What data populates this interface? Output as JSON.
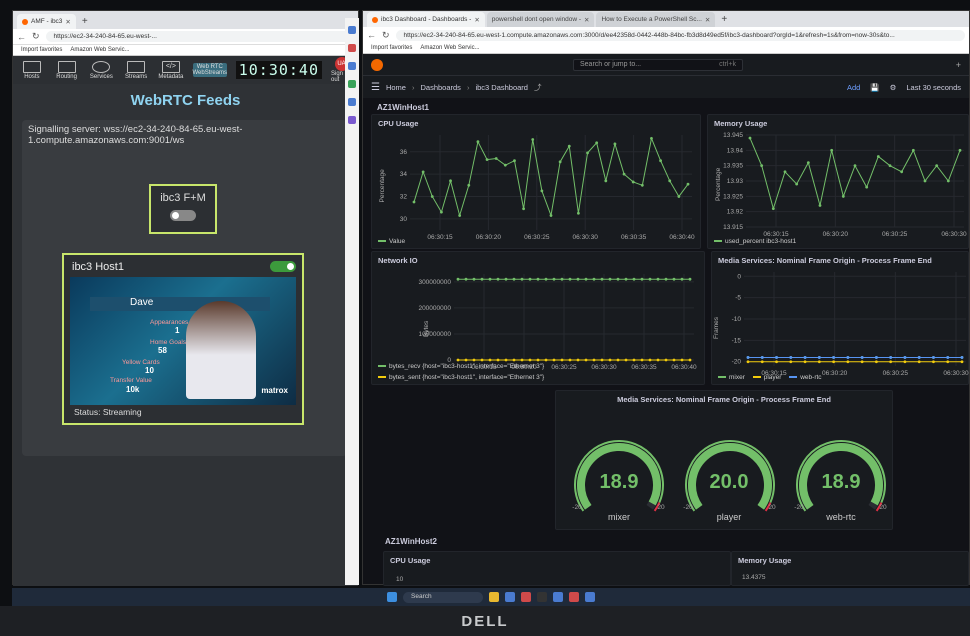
{
  "left_window": {
    "tabs": [
      {
        "label": "AMF - ibc3"
      }
    ],
    "url": "https://ec2-34-240-84-65.eu-west-...",
    "favorites": [
      "Import favorites",
      "Amazon Web Servic..."
    ],
    "nav": [
      {
        "label": "Hosts",
        "icon": "hosts-icon"
      },
      {
        "label": "Routing",
        "icon": "routing-icon"
      },
      {
        "label": "Services",
        "icon": "services-icon"
      },
      {
        "label": "Streams",
        "icon": "streams-icon"
      },
      {
        "label": "Metadata",
        "icon": "metadata-icon"
      },
      {
        "label": "WebStreams",
        "icon": "web-rtc-icon",
        "sub": "Web RTC",
        "active": true
      }
    ],
    "clock": "10:30:40",
    "avatar": "UA",
    "signout": "Sign out",
    "page_title": "WebRTC Feeds",
    "signalling": "Signalling server: wss://ec2-34-240-84-65.eu-west-1.compute.amazonaws.com:9001/ws",
    "fm_label": "ibc3 F+M",
    "host_title": "ibc3 Host1",
    "status": "Status: Streaming",
    "video": {
      "name": "Dave",
      "stats": [
        {
          "label": "Appearances",
          "value": "1"
        },
        {
          "label": "Home Goals",
          "value": "58"
        },
        {
          "label": "Yellow Cards",
          "value": "10"
        },
        {
          "label": "Transfer Value",
          "value": "10k"
        }
      ],
      "brand": "matrox"
    }
  },
  "right_window": {
    "tabs": [
      {
        "label": "ibc3 Dashboard - Dashboards -"
      },
      {
        "label": "powershell dont open window -"
      },
      {
        "label": "How to Execute a PowerShell Sc..."
      }
    ],
    "url": "https://ec2-34-240-84-65.eu-west-1.compute.amazonaws.com:3000/d/ee42358d-0442-448b-84bc-fb3d8d49ed5f/ibc3-dashboard?orgId=1&refresh=1s&from=now-30s&to...",
    "favorites": [
      "Import favorites",
      "Amazon Web Servic..."
    ],
    "search_placeholder": "Search or jump to...",
    "search_shortcut": "ctrl+k",
    "breadcrumb": [
      "Home",
      "Dashboards",
      "ibc3 Dashboard"
    ],
    "add_label": "Add",
    "time_range": "Last 30 seconds",
    "row1": "AZ1WinHost1",
    "row2": "AZ1WinHost2",
    "panels": {
      "cpu": {
        "title": "CPU Usage",
        "ylabel": "Percentage",
        "legend": "Value",
        "yticks": [
          "36",
          "34",
          "32",
          "30"
        ],
        "xticks": [
          "06:30:15",
          "06:30:20",
          "06:30:25",
          "06:30:30",
          "06:30:35",
          "06:30:40"
        ]
      },
      "mem": {
        "title": "Memory Usage",
        "ylabel": "Percentage",
        "legend": "used_percent ibc3-host1",
        "yticks": [
          "13.945",
          "13.94",
          "13.935",
          "13.93",
          "13.925",
          "13.92",
          "13.915"
        ],
        "xticks": [
          "06:30:15",
          "06:30:20",
          "06:30:25",
          "06:30:30"
        ]
      },
      "net": {
        "title": "Network IO",
        "ylabel": "Bytes",
        "yticks": [
          "300000000",
          "200000000",
          "100000000",
          "0"
        ],
        "xticks": [
          "06:30:15",
          "06:30:20",
          "06:30:25",
          "06:30:30",
          "06:30:35",
          "06:30:40"
        ],
        "legend": [
          "bytes_recv {host=\"ibc3-host1\", interface=\"Ethernet 3\"}",
          "bytes_sent {host=\"ibc3-host1\", interface=\"Ethernet 3\"}"
        ]
      },
      "frames": {
        "title": "Media Services: Nominal Frame Origin - Process Frame End",
        "ylabel": "Frames",
        "yticks": [
          "0",
          "-5",
          "-10",
          "-15",
          "-20"
        ],
        "xticks": [
          "06:30:15",
          "06:30:20",
          "06:30:25",
          "06:30:30"
        ],
        "legend": [
          "mixer",
          "player",
          "web-rtc"
        ]
      },
      "gauges": {
        "title": "Media Services: Nominal Frame Origin - Process Frame End",
        "items": [
          {
            "label": "mixer",
            "value": "18.9"
          },
          {
            "label": "player",
            "value": "20.0"
          },
          {
            "label": "web-rtc",
            "value": "18.9"
          }
        ],
        "min": "-20",
        "max": "20"
      },
      "cpu2": {
        "title": "CPU Usage",
        "ytick": "10"
      },
      "mem2": {
        "title": "Memory Usage",
        "value": "13.4375"
      }
    }
  },
  "taskbar": {
    "search": "Search"
  },
  "monitor_brand": "DELL",
  "chart_data": [
    {
      "type": "line",
      "title": "CPU Usage",
      "ylabel": "Percentage",
      "x": [
        "06:30:10",
        "06:30:11",
        "06:30:12",
        "06:30:13",
        "06:30:14",
        "06:30:15",
        "06:30:16",
        "06:30:17",
        "06:30:18",
        "06:30:19",
        "06:30:20",
        "06:30:21",
        "06:30:22",
        "06:30:23",
        "06:30:24",
        "06:30:25",
        "06:30:26",
        "06:30:27",
        "06:30:28",
        "06:30:29",
        "06:30:30",
        "06:30:31",
        "06:30:32",
        "06:30:33",
        "06:30:34",
        "06:30:35",
        "06:30:36",
        "06:30:37",
        "06:30:38",
        "06:30:39",
        "06:30:40"
      ],
      "series": [
        {
          "name": "Value",
          "values": [
            31.5,
            34.2,
            32.0,
            30.6,
            33.4,
            30.3,
            33.0,
            36.9,
            35.3,
            35.4,
            34.8,
            35.2,
            30.9,
            37.1,
            32.5,
            30.3,
            35.1,
            36.5,
            30.5,
            35.9,
            36.8,
            33.4,
            36.7,
            34.0,
            33.3,
            33.0,
            37.2,
            35.2,
            33.4,
            32.0,
            33.1
          ]
        }
      ],
      "ylim": [
        29,
        37.5
      ]
    },
    {
      "type": "line",
      "title": "Memory Usage",
      "ylabel": "Percentage",
      "series": [
        {
          "name": "used_percent ibc3-host1",
          "values": [
            13.944,
            13.935,
            13.921,
            13.933,
            13.929,
            13.936,
            13.922,
            13.94,
            13.925,
            13.935,
            13.928,
            13.938,
            13.935,
            13.933,
            13.94,
            13.93,
            13.935,
            13.93,
            13.94
          ]
        }
      ],
      "ylim": [
        13.915,
        13.945
      ]
    },
    {
      "type": "line",
      "title": "Network IO",
      "ylabel": "Bytes",
      "series": [
        {
          "name": "bytes_recv {host=\"ibc3-host1\", interface=\"Ethernet 3\"}",
          "values": [
            310000000,
            310000000,
            310000000,
            310000000,
            310000000,
            310000000,
            310000000,
            310000000,
            310000000,
            310000000,
            310000000,
            310000000,
            310000000,
            310000000,
            310000000,
            310000000,
            310000000,
            310000000,
            310000000,
            310000000,
            310000000,
            310000000,
            310000000,
            310000000,
            310000000,
            310000000,
            310000000,
            310000000,
            310000000,
            310000000
          ]
        },
        {
          "name": "bytes_sent {host=\"ibc3-host1\", interface=\"Ethernet 3\"}",
          "values": [
            0,
            0,
            0,
            0,
            0,
            0,
            0,
            0,
            0,
            0,
            0,
            0,
            0,
            0,
            0,
            0,
            0,
            0,
            0,
            0,
            0,
            0,
            0,
            0,
            0,
            0,
            0,
            0,
            0,
            0
          ]
        }
      ],
      "ylim": [
        0,
        330000000
      ]
    },
    {
      "type": "line",
      "title": "Media Services: Nominal Frame Origin - Process Frame End",
      "ylabel": "Frames",
      "series": [
        {
          "name": "mixer",
          "values": [
            -19,
            -19,
            -19,
            -19,
            -19,
            -19,
            -19,
            -19,
            -19,
            -19,
            -19,
            -19,
            -19,
            -19,
            -19,
            -19
          ]
        },
        {
          "name": "player",
          "values": [
            -20,
            -20,
            -20,
            -20,
            -20,
            -20,
            -20,
            -20,
            -20,
            -20,
            -20,
            -20,
            -20,
            -20,
            -20,
            -20
          ]
        },
        {
          "name": "web-rtc",
          "values": [
            -19,
            -19,
            -19,
            -19,
            -19,
            -19,
            -19,
            -19,
            -19,
            -19,
            -19,
            -19,
            -19,
            -19,
            -19,
            -19
          ]
        }
      ],
      "ylim": [
        -21,
        1
      ]
    }
  ]
}
